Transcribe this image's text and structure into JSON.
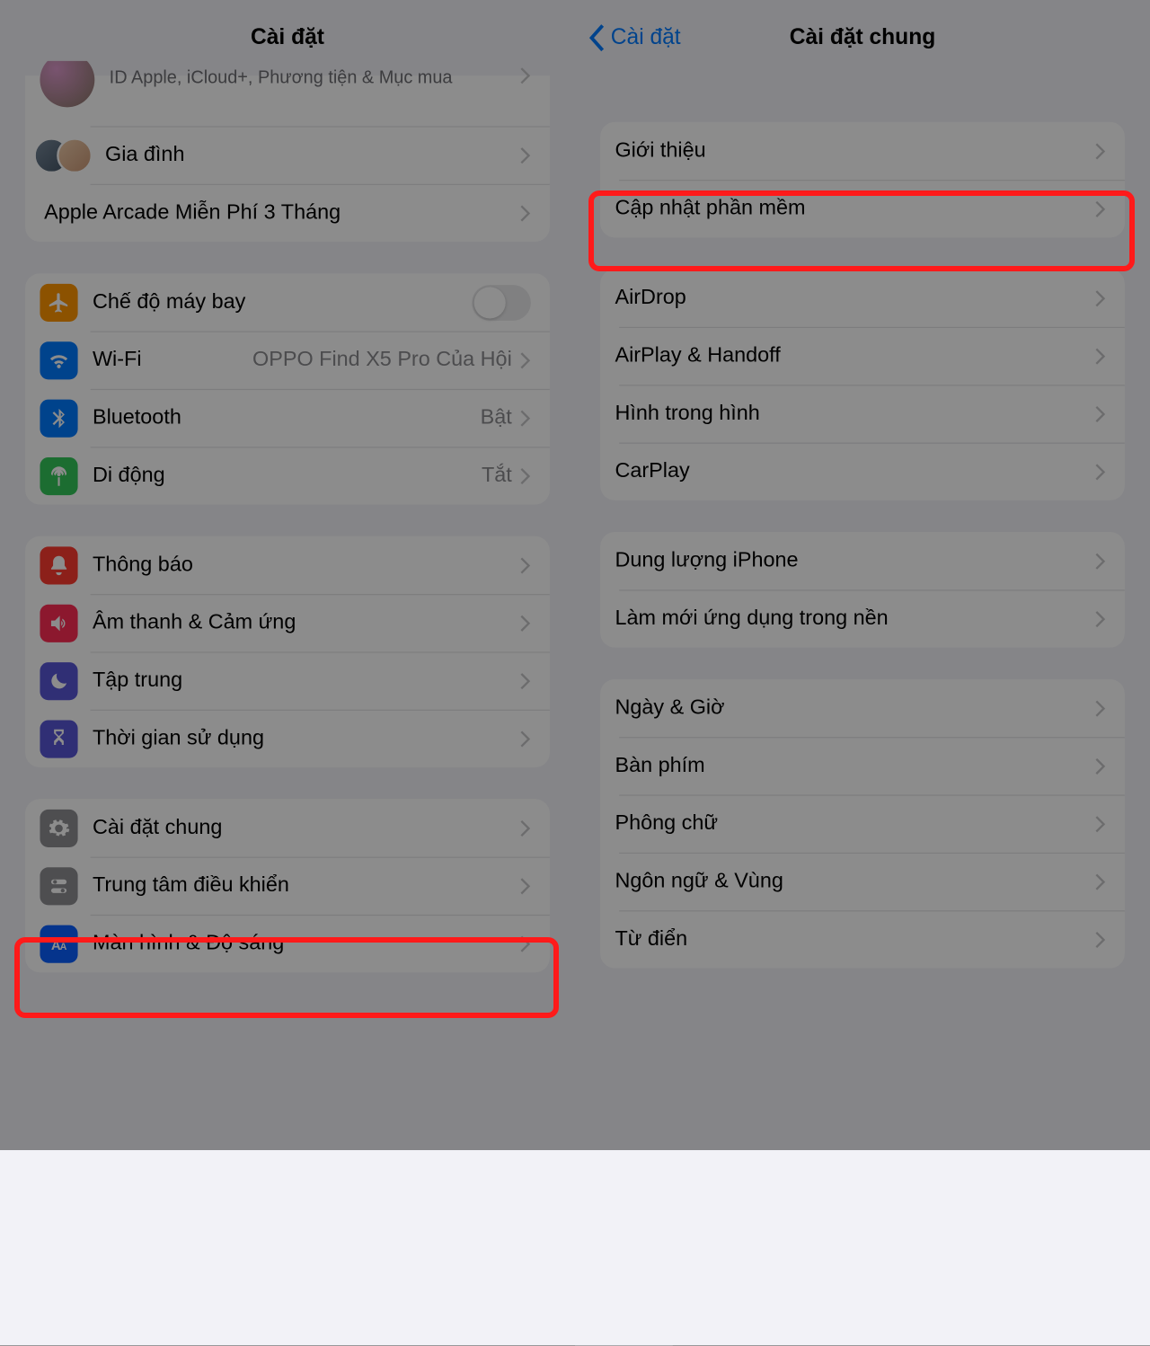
{
  "left": {
    "title": "Cài đặt",
    "account_sub": "ID Apple, iCloud+, Phương tiện & Mục mua",
    "family": "Gia đình",
    "arcade": "Apple Arcade Miễn Phí 3 Tháng",
    "airplane": "Chế độ máy bay",
    "wifi": "Wi-Fi",
    "wifi_value": "OPPO Find X5 Pro Của Hội",
    "bluetooth": "Bluetooth",
    "bluetooth_value": "Bật",
    "cellular": "Di động",
    "cellular_value": "Tắt",
    "notifications": "Thông báo",
    "sounds": "Âm thanh & Cảm ứng",
    "focus": "Tập trung",
    "screentime": "Thời gian sử dụng",
    "general": "Cài đặt chung",
    "control_center": "Trung tâm điều khiển",
    "display": "Màn hình & Độ sáng"
  },
  "right": {
    "back": "Cài đặt",
    "title": "Cài đặt chung",
    "about": "Giới thiệu",
    "software_update": "Cập nhật phần mềm",
    "airdrop": "AirDrop",
    "airplay": "AirPlay & Handoff",
    "pip": "Hình trong hình",
    "carplay": "CarPlay",
    "storage": "Dung lượng iPhone",
    "background_refresh": "Làm mới ứng dụng trong nền",
    "date_time": "Ngày & Giờ",
    "keyboard": "Bàn phím",
    "fonts": "Phông chữ",
    "language": "Ngôn ngữ & Vùng",
    "dictionary": "Từ điển"
  },
  "colors": {
    "orange": "#ff9500",
    "blue": "#007aff",
    "green": "#34c759",
    "red": "#ff3b30",
    "pink": "#ff2d55",
    "indigo": "#5856d6",
    "gray": "#8e8e93",
    "darkblue": "#0a60ff",
    "darkgray": "#6e6e73"
  }
}
